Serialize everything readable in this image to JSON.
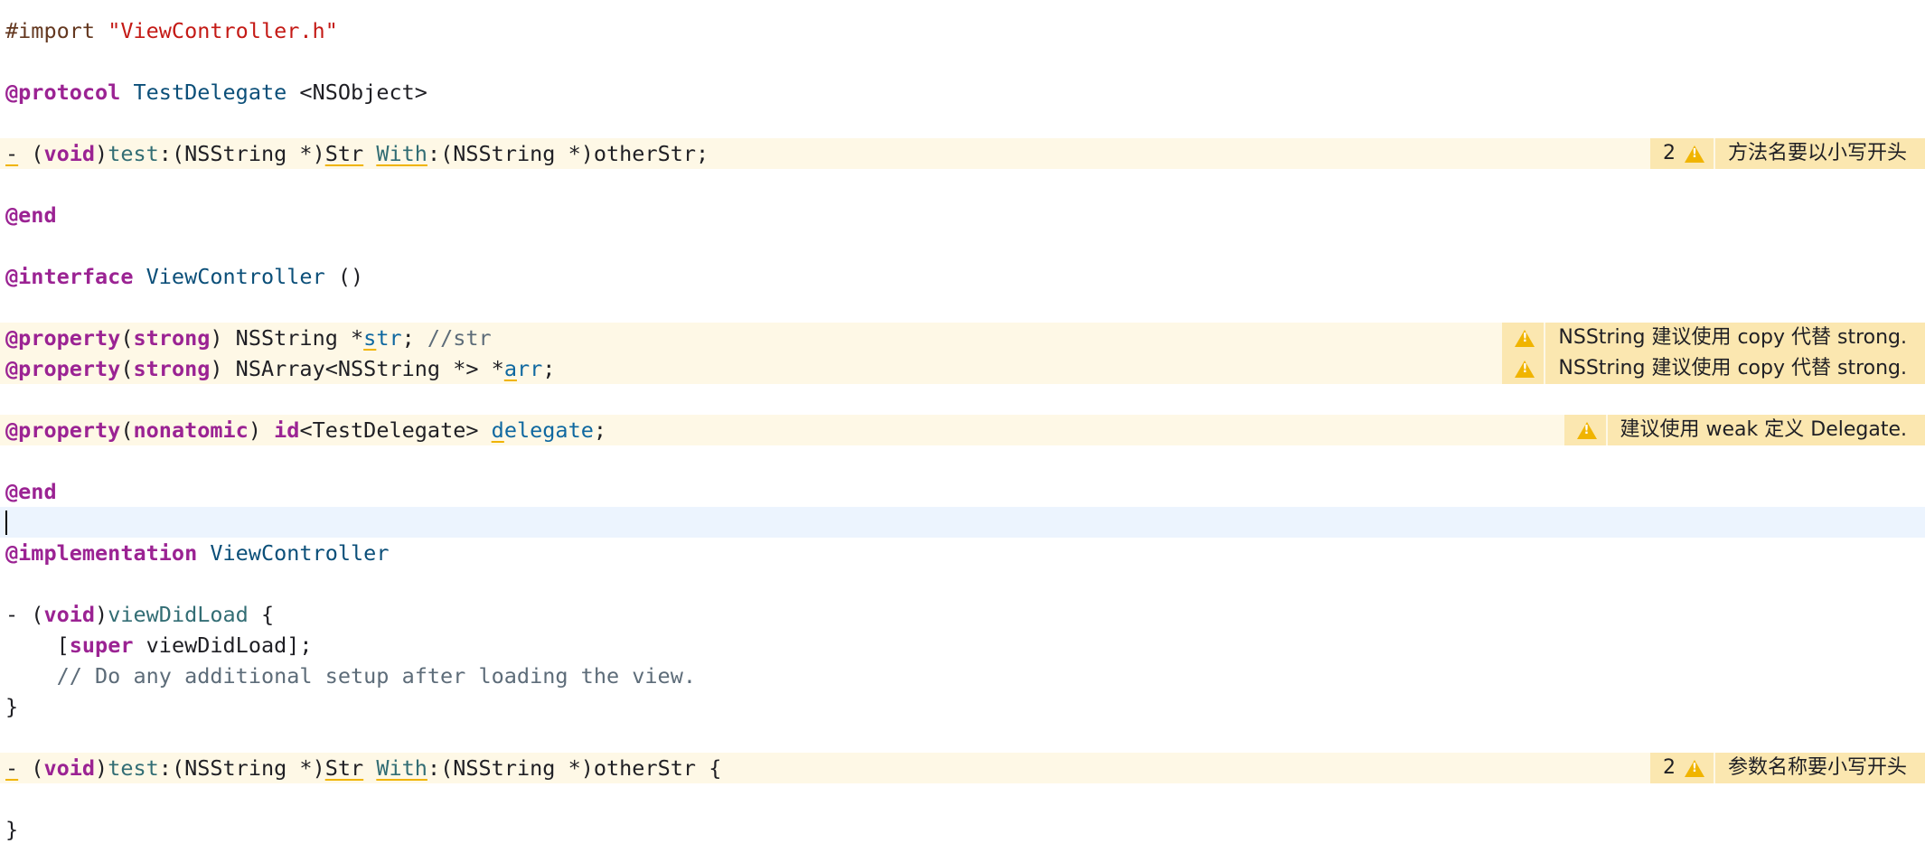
{
  "editor": {
    "lines": {
      "l1": {
        "a": "#import ",
        "b": "\"ViewController.h\""
      },
      "l3": {
        "a": "@protocol",
        "b": " ",
        "c": "TestDelegate",
        "d": " <NSObject>"
      },
      "l5": {
        "a": "-",
        "b": " (",
        "c": "void",
        "d": ")",
        "e": "test",
        "f": ":(NSString *)",
        "g": "Str",
        "h": " ",
        "i": "With",
        "j": ":(NSString *)otherStr;"
      },
      "l7": {
        "a": "@end"
      },
      "l9": {
        "a": "@interface",
        "b": " ",
        "c": "ViewController",
        "d": " ()"
      },
      "l11": {
        "a": "@property",
        "b": "(",
        "c": "strong",
        "d": ") NSString *",
        "e": "s",
        "f": "tr",
        "g": "; ",
        "h": "//str"
      },
      "l12": {
        "a": "@property",
        "b": "(",
        "c": "strong",
        "d": ") NSArray<NSString *> *",
        "e": "a",
        "f": "rr",
        "g": ";"
      },
      "l14": {
        "a": "@property",
        "b": "(",
        "c": "nonatomic",
        "d": ") ",
        "e": "id",
        "f": "<TestDelegate> ",
        "g": "d",
        "h": "elegate",
        "i": ";"
      },
      "l16": {
        "a": "@end"
      },
      "l18": {
        "a": "@implementation",
        "b": " ",
        "c": "ViewController"
      },
      "l20": {
        "a": "- (",
        "b": "void",
        "c": ")",
        "d": "viewDidLoad",
        "e": " {"
      },
      "l21": {
        "a": "    [",
        "b": "super",
        "c": " viewDidLoad];"
      },
      "l22": {
        "a": "    // Do any additional setup after loading the view."
      },
      "l23": {
        "a": "}"
      },
      "l25": {
        "a": "-",
        "b": " (",
        "c": "void",
        "d": ")",
        "e": "test",
        "f": ":(NSString *)",
        "g": "Str",
        "h": " ",
        "i": "With",
        "j": ":(NSString *)otherStr {"
      },
      "l27": {
        "a": "}"
      }
    }
  },
  "warnings": {
    "w1": {
      "count": "2",
      "icon": "warning-triangle-icon",
      "message": "方法名要以小写开头"
    },
    "w2": {
      "icon": "warning-triangle-icon",
      "message": "NSString 建议使用 copy 代替 strong."
    },
    "w3": {
      "icon": "warning-triangle-icon",
      "message": "NSString 建议使用 copy 代替 strong."
    },
    "w4": {
      "icon": "warning-triangle-icon",
      "message": "建议使用 weak 定义 Delegate."
    },
    "w5": {
      "count": "2",
      "icon": "warning-triangle-icon",
      "message": "参数名称要小写开头"
    }
  },
  "colors": {
    "keyword": "#9b2393",
    "string": "#c41a16",
    "preprocessor": "#643820",
    "type": "#0b4f79",
    "function": "#326d74",
    "comment": "#5d6c79",
    "declaration": "#0f68a0",
    "warning_line_bg": "#fef8e6",
    "warning_badge_bg": "#fbe7b0",
    "warning_icon": "#f0b400",
    "current_line_bg": "#ecf4fe"
  }
}
